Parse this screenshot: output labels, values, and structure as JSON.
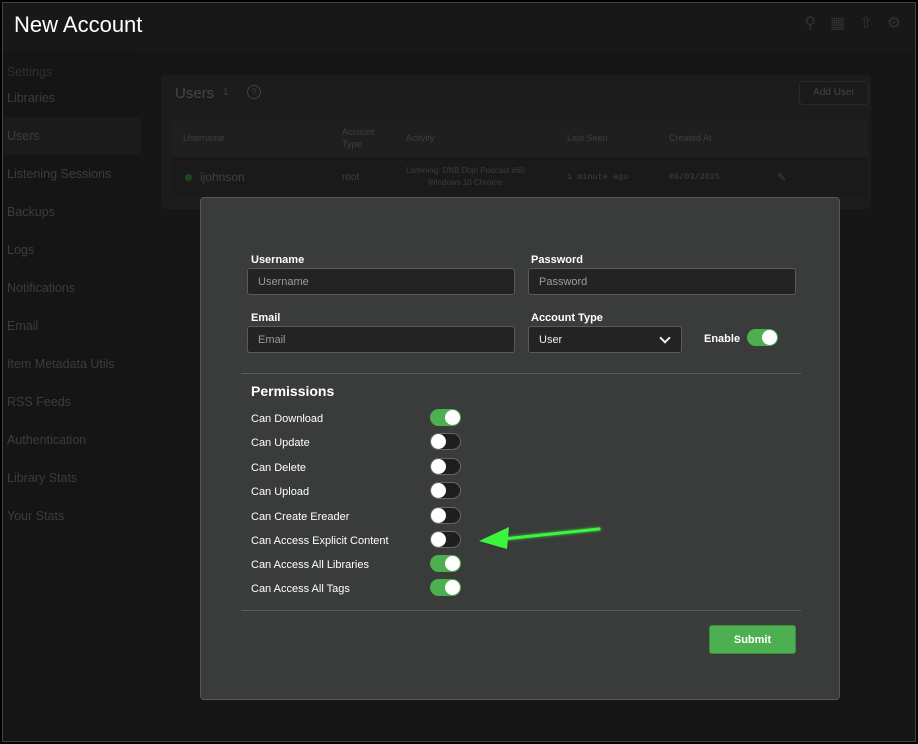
{
  "window": {
    "title": "New Account"
  },
  "sidebar": {
    "items": [
      {
        "label": "Settings"
      },
      {
        "label": "Libraries"
      },
      {
        "label": "Users"
      },
      {
        "label": "Listening Sessions"
      },
      {
        "label": "Backups"
      },
      {
        "label": "Logs"
      },
      {
        "label": "Notifications"
      },
      {
        "label": "Email"
      },
      {
        "label": "Item Metadata Utils"
      },
      {
        "label": "RSS Feeds"
      },
      {
        "label": "Authentication"
      },
      {
        "label": "Library Stats"
      },
      {
        "label": "Your Stats"
      }
    ],
    "active": "Users"
  },
  "users_panel": {
    "title": "Users",
    "count": "1",
    "add_user_label": "Add User",
    "columns": [
      "Username",
      "Account Type",
      "Activity",
      "Last Seen",
      "Created At"
    ],
    "column_account_type_line1": "Account",
    "column_account_type_line2": "Type",
    "rows": [
      {
        "username": "ijohnson",
        "account_type": "root",
        "activity_line1": "Listening: DNB Dojo Podcast #60",
        "activity_line2": "Windows 10 Chrome",
        "last_seen": "1 minute ago",
        "created_at": "06/03/2025"
      }
    ]
  },
  "modal": {
    "username": {
      "label": "Username",
      "placeholder": "Username",
      "value": ""
    },
    "password": {
      "label": "Password",
      "placeholder": "Password",
      "value": ""
    },
    "email": {
      "label": "Email",
      "placeholder": "Email",
      "value": ""
    },
    "account_type": {
      "label": "Account Type",
      "value": "User"
    },
    "enable": {
      "label": "Enable",
      "on": true
    },
    "permissions_heading": "Permissions",
    "permissions": [
      {
        "label": "Can Download",
        "on": true
      },
      {
        "label": "Can Update",
        "on": false
      },
      {
        "label": "Can Delete",
        "on": false
      },
      {
        "label": "Can Upload",
        "on": false
      },
      {
        "label": "Can Create Ereader",
        "on": false
      },
      {
        "label": "Can Access Explicit Content",
        "on": false
      },
      {
        "label": "Can Access All Libraries",
        "on": true
      },
      {
        "label": "Can Access All Tags",
        "on": true
      }
    ],
    "submit_label": "Submit"
  },
  "colors": {
    "accent_green": "#4caf50",
    "annotation_arrow": "#3df53d",
    "modal_bg": "#3a3c3b"
  },
  "annotation": {
    "icon": "green-arrow-pointing-left",
    "target": "Can Access Explicit Content"
  }
}
